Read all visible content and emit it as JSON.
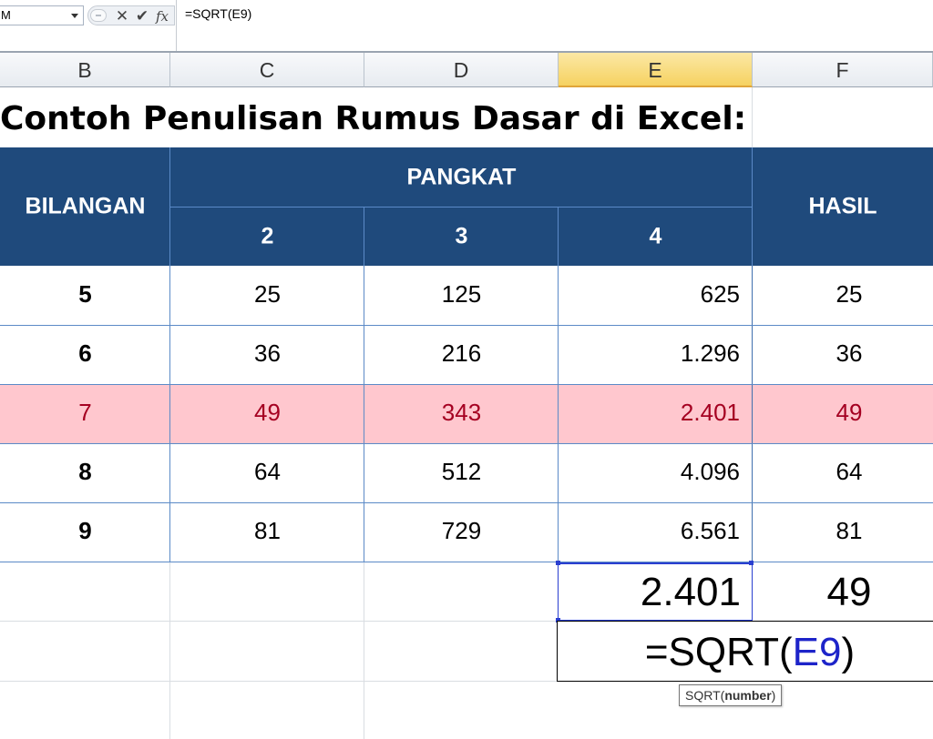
{
  "formula_bar": {
    "name_box": "M",
    "cancel_glyph": "✕",
    "enter_glyph": "✔",
    "fx_glyph": "fx",
    "formula": "=SQRT(E9)"
  },
  "columns": [
    "B",
    "C",
    "D",
    "E",
    "F"
  ],
  "active_column": "E",
  "sheet": {
    "title": "Contoh Penulisan Rumus Dasar di Excel:",
    "headers": {
      "bilangan": "BILANGAN",
      "pangkat": "PANGKAT",
      "pangkat_cols": [
        "2",
        "3",
        "4"
      ],
      "hasil": "HASIL"
    },
    "rows": [
      {
        "bilangan": "5",
        "p2": "25",
        "p3": "125",
        "p4": "625",
        "hasil": "25"
      },
      {
        "bilangan": "6",
        "p2": "36",
        "p3": "216",
        "p4": "1.296",
        "hasil": "36"
      },
      {
        "bilangan": "7",
        "p2": "49",
        "p3": "343",
        "p4": "2.401",
        "hasil": "49"
      },
      {
        "bilangan": "8",
        "p2": "64",
        "p3": "512",
        "p4": "4.096",
        "hasil": "64"
      },
      {
        "bilangan": "9",
        "p2": "81",
        "p3": "729",
        "p4": "6.561",
        "hasil": "81"
      }
    ],
    "highlight_row_index": 2,
    "result": {
      "e_value": "2.401",
      "f_value": "49"
    },
    "editing": {
      "prefix": "=SQRT(",
      "ref": "E9",
      "suffix": ")"
    },
    "tooltip": {
      "fn": "SQRT(",
      "arg": "number",
      "close": ")"
    }
  },
  "colors": {
    "header_fill": "#1f4a7c",
    "highlight_fill": "#ffc7ce",
    "highlight_text": "#a50021",
    "reference_text": "#1d24c9"
  }
}
